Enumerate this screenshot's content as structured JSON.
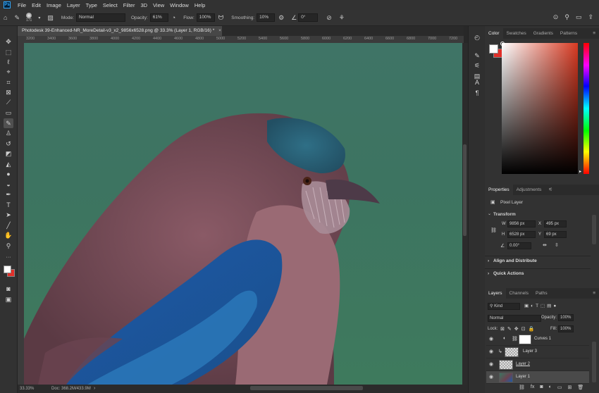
{
  "app": {
    "logo": "Ps"
  },
  "menu": [
    "File",
    "Edit",
    "Image",
    "Layer",
    "Type",
    "Select",
    "Filter",
    "3D",
    "View",
    "Window",
    "Help"
  ],
  "options": {
    "brush_size": "171",
    "mode_label": "Mode:",
    "mode_value": "Normal",
    "opacity_label": "Opacity:",
    "opacity_value": "61%",
    "flow_label": "Flow:",
    "flow_value": "100%",
    "smoothing_label": "Smoothing:",
    "smoothing_value": "10%",
    "angle_value": "0°"
  },
  "document": {
    "tab_title": "Photodesk 39-Enhanced-NR_MoreDetail-v3_x2_9856x6528.png @ 33.3% (Layer 1, RGB/16) *",
    "ruler_ticks": [
      "3200",
      "3400",
      "3600",
      "3800",
      "4000",
      "4200",
      "4400",
      "4600",
      "4800",
      "5000",
      "5200",
      "5400",
      "5600",
      "5800",
      "6000",
      "6200",
      "6400",
      "6600",
      "6800",
      "7000",
      "7200"
    ],
    "zoom": "33.33%",
    "doc_size": "Doc: 368.2M/433.9M"
  },
  "colors": {
    "foreground": "#ffffff",
    "background": "#e0302a",
    "accent": "#31a8ff"
  },
  "color_panel": {
    "tabs": [
      "Color",
      "Swatches",
      "Gradients",
      "Patterns"
    ],
    "active_tab": "Color",
    "picked_hue": "#d83a22"
  },
  "properties_panel": {
    "tabs": [
      "Properties",
      "Adjustments"
    ],
    "type_label": "Pixel Layer",
    "transform_label": "Transform",
    "w_label": "W",
    "w_value": "9856 px",
    "h_label": "H",
    "h_value": "6528 px",
    "x_label": "X",
    "x_value": "495 px",
    "y_label": "Y",
    "y_value": "69 px",
    "angle_value": "0.00°",
    "align_label": "Align and Distribute",
    "quick_actions_label": "Quick Actions"
  },
  "layers_panel": {
    "tabs": [
      "Layers",
      "Channels",
      "Paths"
    ],
    "filter_kind": "Kind",
    "blend_mode": "Normal",
    "opacity_label": "Opacity:",
    "opacity_value": "100%",
    "lock_label": "Lock:",
    "fill_label": "Fill:",
    "fill_value": "100%",
    "layers": [
      {
        "name": "Curves 1",
        "type": "adjustment"
      },
      {
        "name": "Layer 3",
        "type": "pixel"
      },
      {
        "name": "Layer 2",
        "type": "pixel"
      },
      {
        "name": "Layer 1",
        "type": "photo",
        "selected": true
      }
    ],
    "footer_icons": [
      "link-icon",
      "fx-icon",
      "mask-icon",
      "adjustment-icon",
      "group-icon",
      "new-layer-icon",
      "trash-icon"
    ]
  }
}
